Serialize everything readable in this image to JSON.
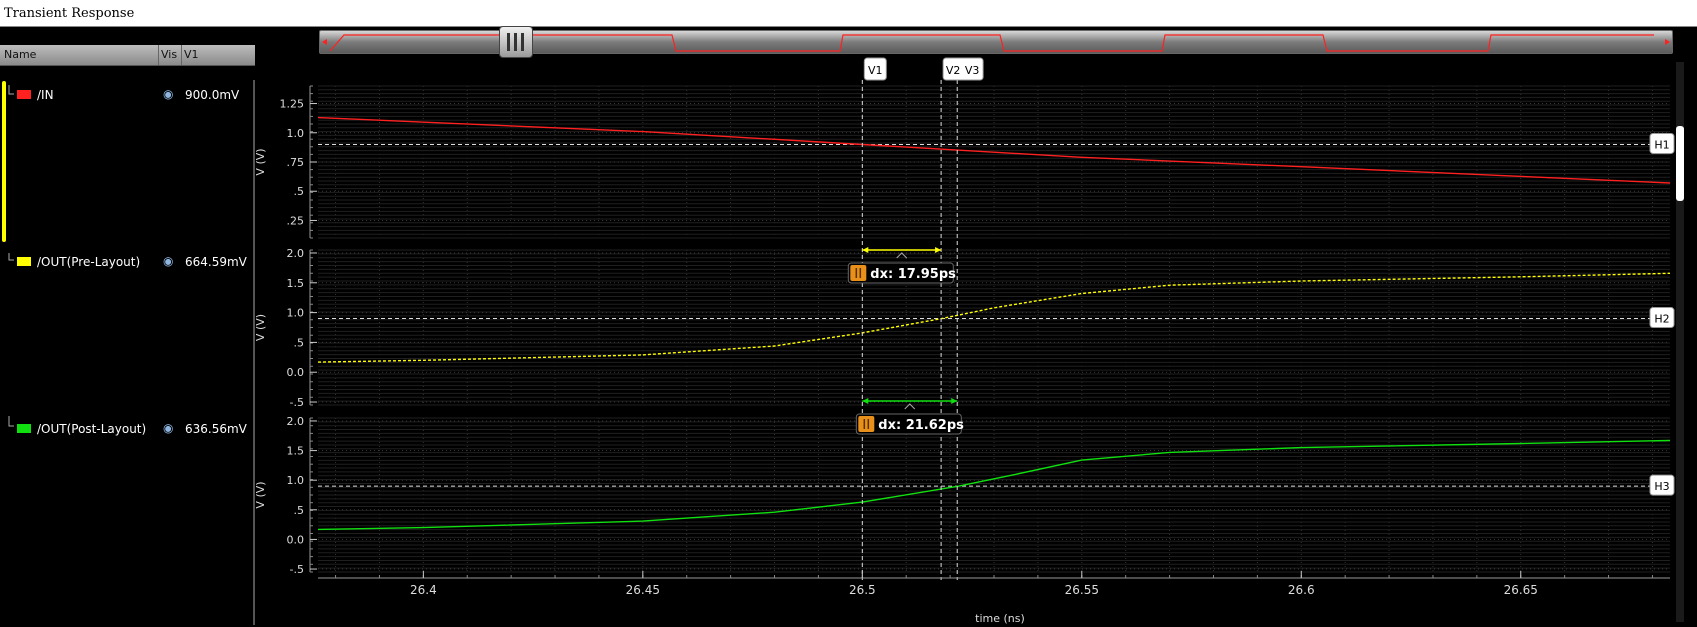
{
  "window": {
    "title": "Transient Response"
  },
  "legend": {
    "headers": {
      "name": "Name",
      "vis": "Vis",
      "v1": "V1"
    },
    "signals": [
      {
        "name": "/IN",
        "value": "900.0mV",
        "color": "#ff2020"
      },
      {
        "name": "/OUT(Pre-Layout)",
        "value": "664.59mV",
        "color": "#ffff00"
      },
      {
        "name": "/OUT(Post-Layout)",
        "value": "636.56mV",
        "color": "#10e010"
      }
    ]
  },
  "scroller": {
    "icon": "scroll-thumb-grip-icon"
  },
  "chart_data": {
    "type": "line",
    "xlabel": "time (ns)",
    "xlim": [
      26.376,
      26.684
    ],
    "xticks": [
      "26.4",
      "26.45",
      "26.5",
      "26.55",
      "26.6",
      "26.65"
    ],
    "xtick_values": [
      26.4,
      26.45,
      26.5,
      26.55,
      26.6,
      26.65
    ],
    "panels": [
      {
        "id": "in",
        "ylabel": "V (V)",
        "ylim": [
          0.1,
          1.4
        ],
        "yticks": [
          ".25",
          ".5",
          ".75",
          "1.0",
          "1.25"
        ],
        "ytick_values": [
          0.25,
          0.5,
          0.75,
          1.0,
          1.25
        ],
        "hmarker": {
          "label": "H1",
          "y": 0.9
        },
        "series": [
          {
            "name": "/IN",
            "color": "#ff2020",
            "dashed": false,
            "x": [
              26.376,
              26.45,
              26.5,
              26.55,
              26.6,
              26.684
            ],
            "y": [
              1.13,
              1.01,
              0.9,
              0.79,
              0.71,
              0.57
            ]
          }
        ]
      },
      {
        "id": "pre",
        "ylabel": "V (V)",
        "ylim": [
          -0.55,
          2.05
        ],
        "yticks": [
          "-.5",
          "0.0",
          ".5",
          "1.0",
          "1.5",
          "2.0"
        ],
        "ytick_values": [
          -0.5,
          0.0,
          0.5,
          1.0,
          1.5,
          2.0
        ],
        "hmarker": {
          "label": "H2",
          "y": 0.9
        },
        "series": [
          {
            "name": "/OUT(Pre-Layout)",
            "color": "#ffff00",
            "dashed": true,
            "x": [
              26.376,
              26.4,
              26.45,
              26.48,
              26.5,
              26.518,
              26.53,
              26.55,
              26.57,
              26.6,
              26.65,
              26.684
            ],
            "y": [
              0.17,
              0.2,
              0.29,
              0.44,
              0.66,
              0.9,
              1.08,
              1.32,
              1.46,
              1.53,
              1.6,
              1.66
            ]
          }
        ]
      },
      {
        "id": "post",
        "ylabel": "V (V)",
        "ylim": [
          -0.55,
          2.05
        ],
        "yticks": [
          "-.5",
          "0.0",
          ".5",
          "1.0",
          "1.5",
          "2.0"
        ],
        "ytick_values": [
          -0.5,
          0.0,
          0.5,
          1.0,
          1.5,
          2.0
        ],
        "hmarker": {
          "label": "H3",
          "y": 0.9
        },
        "series": [
          {
            "name": "/OUT(Post-Layout)",
            "color": "#10e010",
            "dashed": false,
            "x": [
              26.376,
              26.4,
              26.45,
              26.48,
              26.5,
              26.522,
              26.535,
              26.55,
              26.57,
              26.6,
              26.65,
              26.684
            ],
            "y": [
              0.17,
              0.2,
              0.31,
              0.46,
              0.63,
              0.9,
              1.1,
              1.34,
              1.47,
              1.55,
              1.62,
              1.67
            ]
          }
        ]
      }
    ],
    "vmarkers": [
      {
        "label": "V1",
        "x": 26.5
      },
      {
        "label": "V2",
        "x": 26.51795
      },
      {
        "label": "V3",
        "x": 26.52162
      }
    ],
    "deltas": [
      {
        "panel": "pre",
        "label": "dx: 17.95ps",
        "x1": 26.5,
        "x2": 26.51795,
        "color": "#ffff00",
        "icon": "delta-marker-icon"
      },
      {
        "panel": "post",
        "label": "dx: 21.62ps",
        "x1": 26.5,
        "x2": 26.52162,
        "color": "#10e010",
        "icon": "delta-marker-icon"
      }
    ]
  }
}
